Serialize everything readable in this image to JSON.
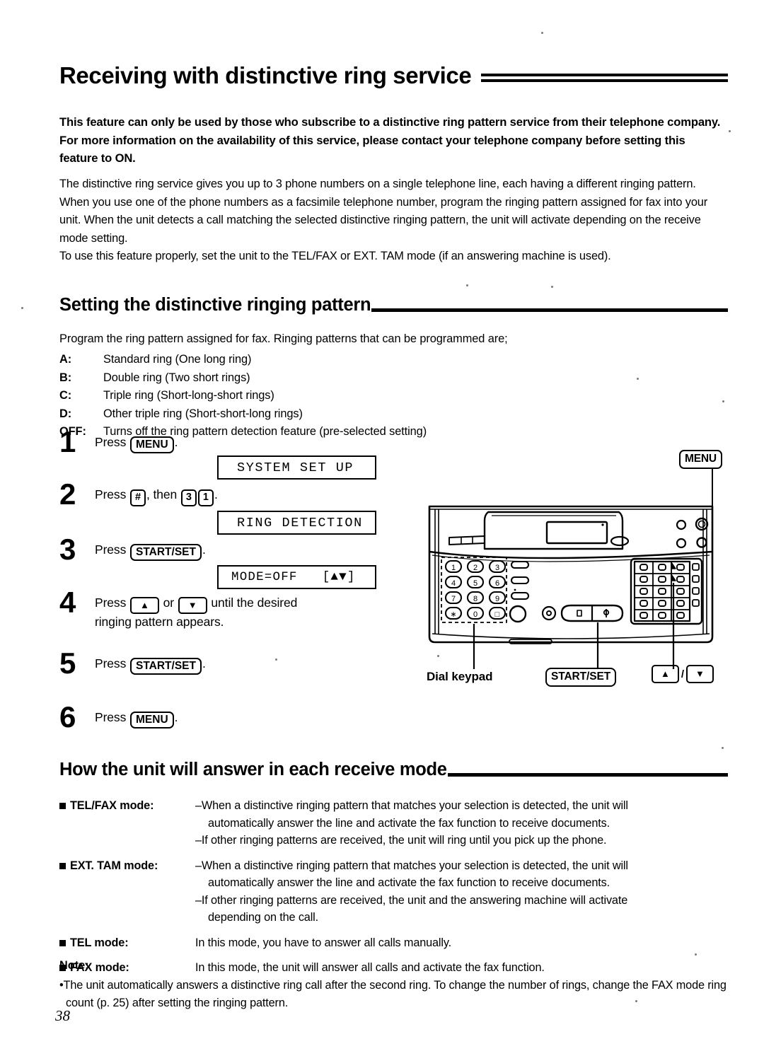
{
  "document": {
    "title": "Receiving with distinctive ring service",
    "page_number": "38"
  },
  "intro": {
    "bold_notice": "This feature can only be used by those who subscribe to a distinctive ring pattern service from their telephone company. For more information on the availability of this service, please contact your telephone company before setting this feature to ON.",
    "paragraphs": [
      "The distinctive ring service gives you up to 3 phone numbers on a single telephone line, each having a different ringing pattern.",
      "When you use one of the phone numbers as a facsimile telephone number, program the ringing pattern assigned for fax into your unit. When the unit detects a call matching the selected distinctive ringing pattern, the unit will activate depending on the receive mode setting.",
      "To use this feature properly, set the unit to the TEL/FAX or EXT. TAM mode (if an answering machine is used)."
    ]
  },
  "section_setting": {
    "heading": "Setting the distinctive ringing pattern",
    "intro": "Program the ring pattern assigned for fax. Ringing patterns that can be programmed are;",
    "patterns": [
      {
        "key": "A:",
        "desc": "Standard ring (One long ring)"
      },
      {
        "key": "B:",
        "desc": "Double ring (Two short rings)"
      },
      {
        "key": "C:",
        "desc": "Triple ring (Short-long-short rings)"
      },
      {
        "key": "D:",
        "desc": "Other triple ring (Short-short-long rings)"
      },
      {
        "key": "OFF:",
        "desc": "Turns off the ring pattern detection feature (pre-selected setting)"
      }
    ],
    "steps": [
      {
        "num": "1",
        "press": "Press",
        "key": "MENU",
        "tail": "."
      },
      {
        "num": "2",
        "press": "Press",
        "key": "#",
        "mid": ", then",
        "key2": "3",
        "key3": "1",
        "tail": "."
      },
      {
        "num": "3",
        "press": "Press",
        "key": "START/SET",
        "tail": "."
      },
      {
        "num": "4",
        "press": "Press",
        "mid": "or",
        "tail": "until the desired",
        "line2": "ringing pattern appears."
      },
      {
        "num": "5",
        "press": "Press",
        "key": "START/SET",
        "tail": "."
      },
      {
        "num": "6",
        "press": "Press",
        "key": "MENU",
        "tail": "."
      }
    ],
    "displays": [
      {
        "id": "lcd1",
        "text": "SYSTEM SET UP"
      },
      {
        "id": "lcd2",
        "text": "RING DETECTION"
      },
      {
        "id": "lcd3",
        "text": "MODE=OFF   [▲▼]"
      }
    ]
  },
  "figure": {
    "callout_menu": "MENU",
    "label_dial_keypad": "Dial keypad",
    "label_start_set": "START/SET",
    "label_arrow_separator": "/",
    "keypad_keys": [
      "1",
      "2",
      "3",
      "4",
      "5",
      "6",
      "7",
      "8",
      "9",
      "∗",
      "0",
      "□"
    ]
  },
  "section_modes": {
    "heading": "How the unit will answer in each receive mode",
    "rows": [
      {
        "label": "TEL/FAX mode:",
        "lines": [
          "–When a distinctive ringing pattern that matches your selection is detected, the unit will",
          "automatically answer the line and activate the fax function to receive documents.",
          "–If other ringing patterns are received, the unit will ring until you pick up the phone."
        ]
      },
      {
        "label": "EXT. TAM mode:",
        "lines": [
          "–When a distinctive ringing pattern that matches your selection is detected, the unit will",
          "automatically answer the line and activate the fax function to receive documents.",
          "–If other ringing patterns are received, the unit and the answering machine will activate",
          "depending on the call."
        ]
      },
      {
        "label": "TEL mode:",
        "lines": [
          "In this mode, you have to answer all calls manually."
        ]
      },
      {
        "label": "FAX mode:",
        "lines": [
          "In this mode, the unit will answer all calls and activate the fax function."
        ]
      }
    ]
  },
  "note": {
    "heading": "Note:",
    "text": "•The unit automatically answers a distinctive ring call after the second ring. To change the number of rings, change the FAX mode ring count (p. 25) after setting the ringing pattern."
  }
}
